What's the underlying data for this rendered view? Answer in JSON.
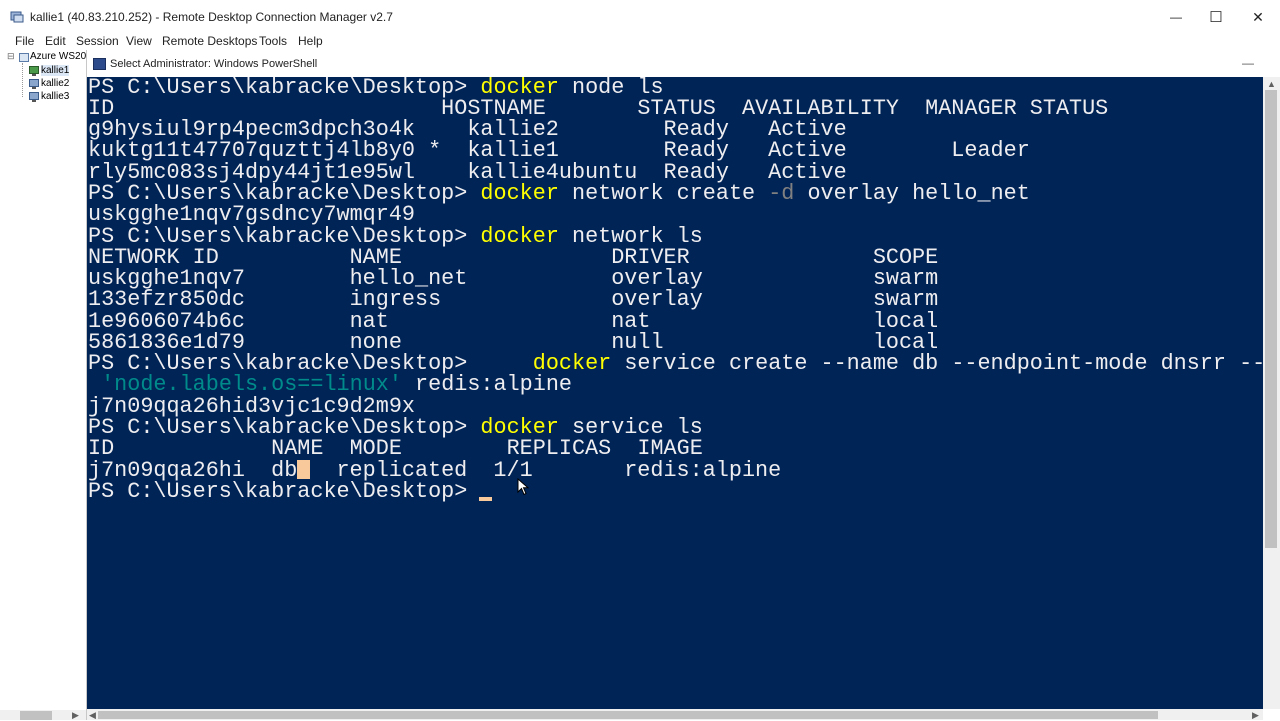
{
  "window": {
    "title": "kallie1 (40.83.210.252) - Remote Desktop Connection Manager v2.7",
    "minimize_glyph": "—",
    "maximize_glyph": "☐",
    "close_glyph": "✕"
  },
  "menu": [
    "File",
    "Edit",
    "Session",
    "View",
    "Remote Desktops",
    "Tools",
    "Help"
  ],
  "tree": {
    "group": "Azure WS20",
    "expander": "⊟",
    "servers": [
      "kallie1",
      "kallie2",
      "kallie3"
    ]
  },
  "remote": {
    "title": "Select Administrator: Windows PowerShell",
    "minimize_glyph": "—"
  },
  "console": {
    "prompt": "PS C:\\Users\\kabracke\\Desktop> ",
    "cmd1": "docker",
    "cmd1_rest": " node ls",
    "node_header": "ID                         HOSTNAME       STATUS  AVAILABILITY  MANAGER STATUS",
    "node_row1": "g9hysiul9rp4pecm3dpch3o4k    kallie2        Ready   Active",
    "node_row2": "kuktg11t47707quzttj4lb8y0 *  kallie1        Ready   Active        Leader",
    "node_row3": "rly5mc083sj4dpy44jt1e95wl    kallie4ubuntu  Ready   Active",
    "cmd2": "docker",
    "cmd2_a": " network create ",
    "cmd2_param": "-d",
    "cmd2_b": " overlay hello_net",
    "net_id_out": "uskgghe1nqv7gsdncy7wmqr49",
    "cmd3": "docker",
    "cmd3_rest": " network ls",
    "net_header": "NETWORK ID          NAME                DRIVER              SCOPE",
    "net_row1": "uskgghe1nqv7        hello_net           overlay             swarm",
    "net_row2": "133efzr850dc        ingress             overlay             swarm",
    "net_row3": "1e9606074b6c        nat                 nat                 local",
    "net_row4": "5861836e1d79        none                null                local",
    "cmd4_pre": "    ",
    "cmd4": "docker",
    "cmd4_rest": " service create --name db --endpoint-mode dnsrr --c",
    "cmd4_cont_pre": " ",
    "cmd4_str": "'node.labels.os==linux'",
    "cmd4_cont_rest": " redis:alpine",
    "svc_id_out": "j7n09qqa26hid3vjc1c9d2m9x",
    "cmd5": "docker",
    "cmd5_rest": " service ls",
    "svc_header": "ID            NAME  MODE        REPLICAS  IMAGE",
    "svc_row_a": "j7n09qqa26hi  db",
    "svc_row_b": "  replicated  1/1       redis:alpine"
  }
}
